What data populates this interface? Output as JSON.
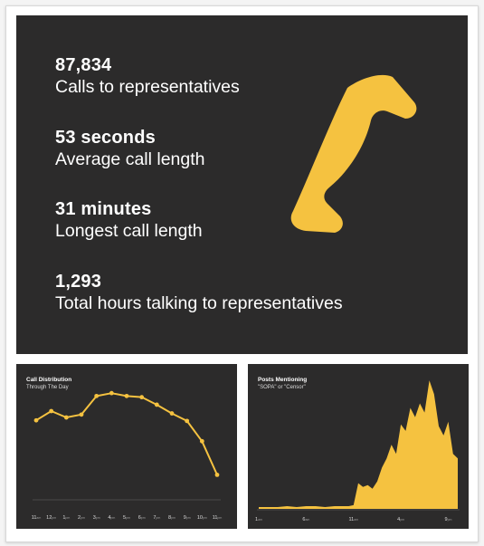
{
  "stats": [
    {
      "value": "87,834",
      "label": "Calls to representatives"
    },
    {
      "value": "53 seconds",
      "label": "Average call length"
    },
    {
      "value": "31 minutes",
      "label": "Longest call length"
    },
    {
      "value": "1,293",
      "label": "Total hours talking to representatives"
    }
  ],
  "icon": "phone-handset-icon",
  "colors": {
    "panel": "#2c2b2b",
    "accent": "#f5c240",
    "text": "#ffffff"
  },
  "chart_data": [
    {
      "type": "line",
      "title": "Call Distribution",
      "subtitle": "Through The Day",
      "categories": [
        "11am",
        "12pm",
        "1pm",
        "2pm",
        "3pm",
        "4pm",
        "5pm",
        "6pm",
        "7pm",
        "8pm",
        "9pm",
        "10pm",
        "11pm"
      ],
      "tick_labels": [
        "11",
        "12",
        "1",
        "2",
        "3",
        "4",
        "5",
        "6",
        "7",
        "8",
        "9",
        "10",
        "11"
      ],
      "tick_suffixes": [
        "am",
        "pm",
        "pm",
        "pm",
        "pm",
        "pm",
        "pm",
        "pm",
        "pm",
        "pm",
        "pm",
        "pm",
        "pm"
      ],
      "values": [
        6700,
        7500,
        6950,
        7200,
        8800,
        9050,
        8800,
        8700,
        8050,
        7300,
        6650,
        4900,
        2000
      ],
      "ylim": [
        0,
        10000
      ],
      "grid": false
    },
    {
      "type": "area",
      "title": "Posts Mentioning",
      "subtitle": "\"SOPA\" or \"Censor\"",
      "x_ticks": [
        {
          "label": "1",
          "suffix": "am"
        },
        {
          "label": "6",
          "suffix": "am"
        },
        {
          "label": "11",
          "suffix": "am"
        },
        {
          "label": "4",
          "suffix": "pm"
        },
        {
          "label": "9",
          "suffix": "pm"
        }
      ],
      "x": [
        1,
        2,
        3,
        4,
        5,
        6,
        7,
        8,
        9,
        10,
        10.5,
        11,
        11.5,
        12,
        12.5,
        13,
        13.5,
        14,
        14.5,
        15,
        15.5,
        16,
        16.5,
        17,
        17.5,
        18,
        18.5,
        19,
        19.5,
        20,
        20.5,
        21,
        21.5,
        22
      ],
      "values": [
        2,
        2,
        2,
        3,
        2,
        3,
        3,
        2,
        3,
        3,
        3,
        4,
        28,
        24,
        26,
        22,
        30,
        45,
        55,
        70,
        60,
        92,
        85,
        110,
        100,
        115,
        105,
        140,
        125,
        90,
        80,
        95,
        60,
        55
      ],
      "xlim": [
        1,
        22
      ],
      "ylim": [
        0,
        150
      ],
      "grid": false
    }
  ]
}
